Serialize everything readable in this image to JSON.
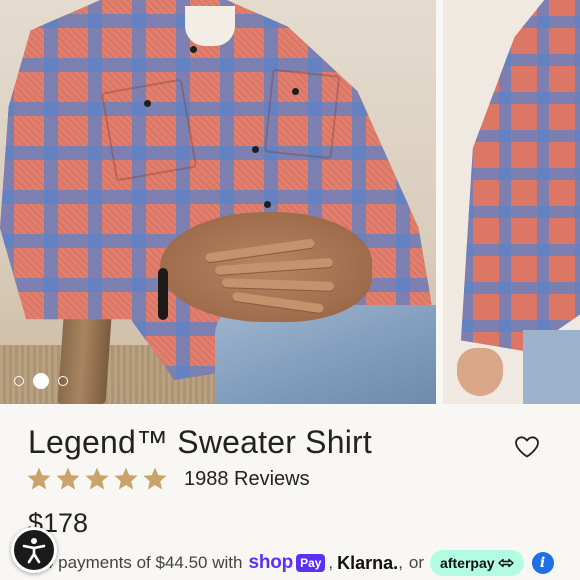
{
  "product": {
    "title": "Legend™ Sweater Shirt",
    "rating": 5,
    "rating_max": 5,
    "reviews_label": "1988 Reviews",
    "price": "$178"
  },
  "gallery": {
    "slide_count": 3,
    "active_index": 1
  },
  "payments": {
    "installments_text": "4 payments of $44.50 with",
    "shop_label": "shop",
    "pay_badge": "Pay",
    "separator": ",",
    "klarna_label": "Klarna.",
    "separator2": ",",
    "or_label": "or",
    "afterpay_label": "afterpay",
    "info_glyph": "i"
  },
  "icons": {
    "wishlist": "heart-outline-icon",
    "star": "star-icon",
    "info": "info-icon",
    "accessibility": "accessibility-person-icon"
  },
  "colors": {
    "star": "#c9a36a",
    "shop_pay": "#5a31f4",
    "afterpay_bg": "#b2fce4",
    "info_bg": "#1f6fe5",
    "text": "#222222"
  }
}
